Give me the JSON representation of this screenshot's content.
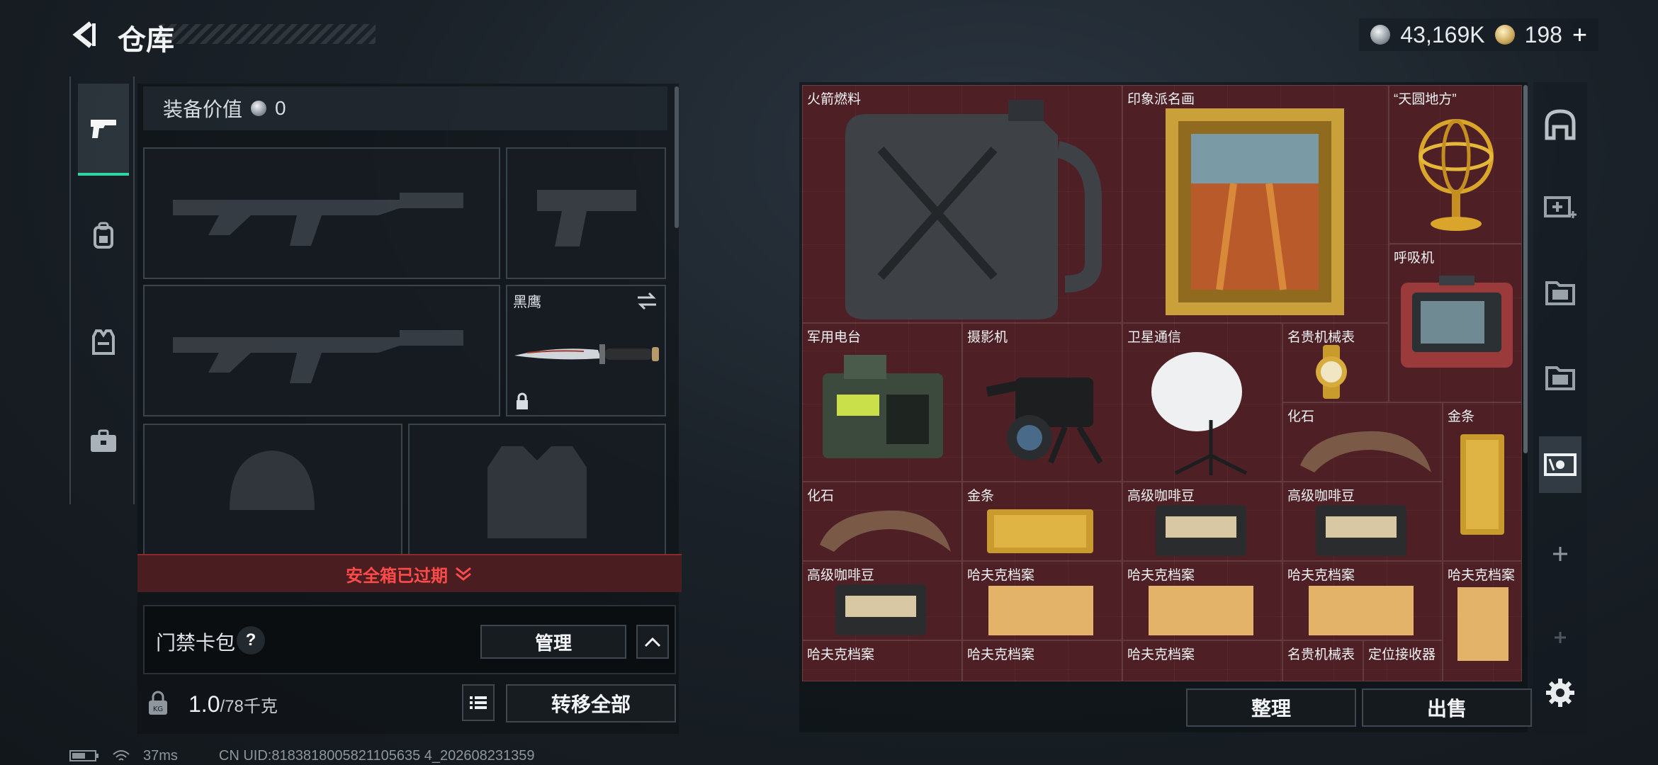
{
  "header": {
    "title": "仓库",
    "silver": "43,169K",
    "gold": "198",
    "add_label": "+"
  },
  "equipment": {
    "value_label": "装备价值",
    "value": "0",
    "knife_slot_label": "黑鹰",
    "safe_box_status": "安全箱已过期",
    "keycard_label": "门禁卡包",
    "help_label": "?",
    "manage_label": "管理",
    "weight": "1.0",
    "weight_max": "/78千克",
    "transfer_all_label": "转移全部"
  },
  "storage": {
    "items": [
      {
        "name": "火箭燃料"
      },
      {
        "name": "印象派名画"
      },
      {
        "name": "“天圆地方”"
      },
      {
        "name": "呼吸机"
      },
      {
        "name": "军用电台"
      },
      {
        "name": "摄影机"
      },
      {
        "name": "卫星通信"
      },
      {
        "name": "名贵机械表"
      },
      {
        "name": "化石"
      },
      {
        "name": "金条"
      },
      {
        "name": "化石"
      },
      {
        "name": "金条"
      },
      {
        "name": "高级咖啡豆"
      },
      {
        "name": "高级咖啡豆"
      },
      {
        "name": "高级咖啡豆"
      },
      {
        "name": "哈夫克档案"
      },
      {
        "name": "哈夫克档案"
      },
      {
        "name": "哈夫克档案"
      },
      {
        "name": "哈夫克档案"
      },
      {
        "name": "哈夫克档案"
      },
      {
        "name": "哈夫克档案"
      },
      {
        "name": "哈夫克档案"
      },
      {
        "name": "名贵机械表"
      },
      {
        "name": "定位接收器"
      }
    ],
    "sort_label": "整理",
    "sell_label": "出售"
  },
  "status": {
    "ping": "37ms",
    "uid": "CN UID:8183818005821105635 4_202608231359"
  },
  "icons": {
    "back": "chevron-left-icon",
    "weapon_tab": "pistol-icon",
    "backpack_tab": "backpack-icon",
    "vest_tab": "vest-icon",
    "case_tab": "briefcase-icon",
    "right_tabs": [
      "vault-icon",
      "add-storage-icon",
      "folder-icon",
      "folder-icon",
      "ticket-icon",
      "plus-icon",
      "plus-icon",
      "gear-icon"
    ]
  },
  "colors": {
    "accent": "#2fd6a5",
    "alert": "#ff4a4a",
    "grid_bg": "#3d1e22"
  }
}
